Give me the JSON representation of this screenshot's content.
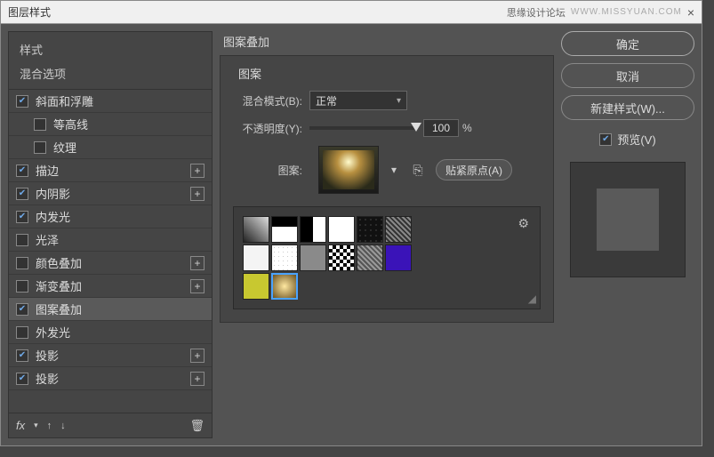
{
  "title": "图层样式",
  "forum": "思缘设计论坛",
  "url": "WWW.MISSYUAN.COM",
  "left": {
    "header": "样式",
    "sub": "混合选项",
    "items": [
      {
        "label": "斜面和浮雕",
        "checked": true,
        "plus": false,
        "indent": false
      },
      {
        "label": "等高线",
        "checked": false,
        "plus": false,
        "indent": true
      },
      {
        "label": "纹理",
        "checked": false,
        "plus": false,
        "indent": true
      },
      {
        "label": "描边",
        "checked": true,
        "plus": true,
        "indent": false
      },
      {
        "label": "内阴影",
        "checked": true,
        "plus": true,
        "indent": false
      },
      {
        "label": "内发光",
        "checked": true,
        "plus": false,
        "indent": false
      },
      {
        "label": "光泽",
        "checked": false,
        "plus": false,
        "indent": false
      },
      {
        "label": "颜色叠加",
        "checked": false,
        "plus": true,
        "indent": false
      },
      {
        "label": "渐变叠加",
        "checked": false,
        "plus": true,
        "indent": false
      },
      {
        "label": "图案叠加",
        "checked": true,
        "plus": false,
        "indent": false,
        "selected": true
      },
      {
        "label": "外发光",
        "checked": false,
        "plus": false,
        "indent": false
      },
      {
        "label": "投影",
        "checked": true,
        "plus": true,
        "indent": false
      },
      {
        "label": "投影",
        "checked": true,
        "plus": true,
        "indent": false
      }
    ],
    "fx": "fx"
  },
  "middle": {
    "title": "图案叠加",
    "panel_title": "图案",
    "blend_label": "混合模式(B):",
    "blend_value": "正常",
    "opacity_label": "不透明度(Y):",
    "opacity_value": "100",
    "opacity_unit": "%",
    "pattern_label": "图案:",
    "snap_btn": "贴紧原点(A)"
  },
  "right": {
    "ok": "确定",
    "cancel": "取消",
    "newstyle": "新建样式(W)...",
    "preview": "预览(V)"
  },
  "swatches": [
    {
      "bg": "linear-gradient(45deg,#222,#ddd)"
    },
    {
      "bg": "linear-gradient(#000,#000 40%,#fff 40%,#fff)"
    },
    {
      "bg": "linear-gradient(90deg,#000 50%,#fff 50%)"
    },
    {
      "bg": "#fff"
    },
    {
      "bg": "radial-gradient(#333 20%, transparent 20%) 0 0/6px 6px,#111"
    },
    {
      "bg": "repeating-linear-gradient(45deg,#888,#888 2px,#333 2px,#333 4px)"
    },
    {
      "bg": "#f4f4f4"
    },
    {
      "bg": "radial-gradient(#ccc 20%, transparent 20%) 0 0/5px 5px,#fff"
    },
    {
      "bg": "#8a8a8a"
    },
    {
      "bg": "repeating-conic-gradient(#000 0 25%,#fff 0 50%) 0 0/8px 8px"
    },
    {
      "bg": "repeating-linear-gradient(45deg,#555,#555 2px,#999 2px,#999 4px)"
    },
    {
      "bg": "#3a13b8"
    },
    {
      "bg": "#c8c830"
    },
    {
      "bg": "radial-gradient(circle,#ffe8a0,#6a5020)",
      "sel": true
    }
  ]
}
